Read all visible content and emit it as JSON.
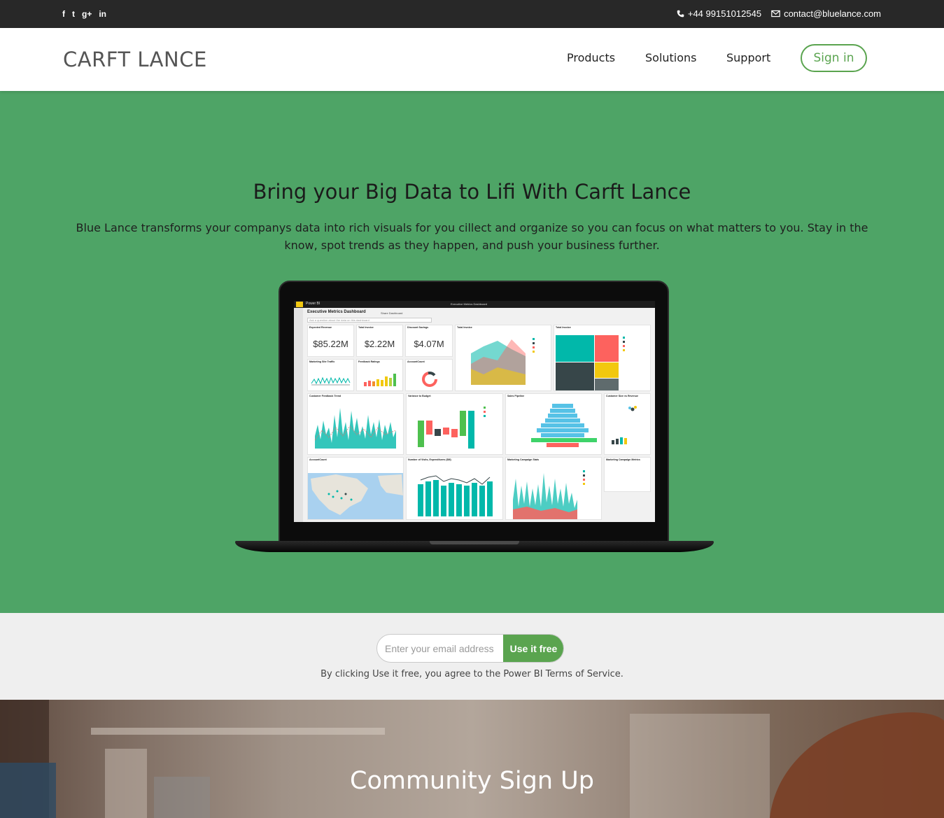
{
  "topbar": {
    "social_icons": [
      {
        "icon": "facebook-icon",
        "glyph": "f"
      },
      {
        "icon": "twitter-icon",
        "glyph": "t"
      },
      {
        "icon": "google-plus-icon",
        "glyph": "g+"
      },
      {
        "icon": "linkedin-icon",
        "glyph": "in"
      }
    ],
    "phone": "+44 99151012545",
    "email": "contact@bluelance.com"
  },
  "nav": {
    "logo": "CARFT LANCE",
    "links": [
      "Products",
      "Solutions",
      "Support"
    ],
    "signin": "Sign in"
  },
  "hero": {
    "title": "Bring your Big Data to Lifi With Carft Lance",
    "description": "Blue Lance transforms your companys data into rich visuals for you cillect and organize so you can focus on what matters to you. Stay in the know, spot trends as they happen, and push your business further."
  },
  "dashboard": {
    "app_name": "Power BI",
    "window_title": "Executive Metrics Dashboard",
    "heading": "Executive Metrics Dashboard",
    "share": "Share Dashboard",
    "qa_placeholder": "Ask a question about the data on this dashboard",
    "kpis": [
      {
        "title": "Expected Revenue",
        "value": "$85.22M"
      },
      {
        "title": "Total Invoice",
        "value": "$2.22M"
      },
      {
        "title": "Discount Savings",
        "value": "$4.07M"
      }
    ],
    "tiles": [
      "Total Invoice",
      "Total Invoice",
      "Marketing Site Traffic",
      "Feedback Ratings",
      "AccountCount",
      "Customer Feedback Trend",
      "Variance to Budget",
      "Sales Pipeline",
      "Customer Size vs Revenue",
      "AccountCount",
      "Number of Visits, Expenditures ($M)",
      "Marketing Campaign Stats",
      "Marketing Campaign Metrics"
    ]
  },
  "signup": {
    "email_placeholder": "Enter your email address",
    "button": "Use it free",
    "terms": "By clicking Use it free, you agree to the Power BI Terms of Service."
  },
  "community": {
    "title": "Community Sign Up"
  },
  "colors": {
    "brand_green": "#5aa44f",
    "hero_green": "#4ea466",
    "topbar": "#282828"
  }
}
